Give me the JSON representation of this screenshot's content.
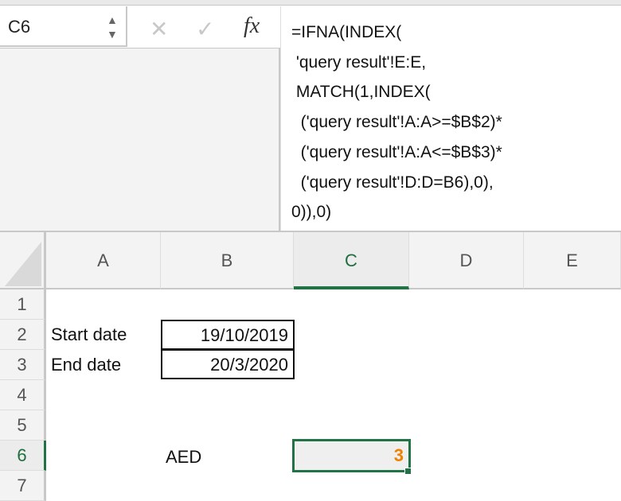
{
  "name_box": {
    "value": "C6"
  },
  "formula_bar": {
    "cancel_icon": "✕",
    "enter_icon": "✓",
    "fx_label": "fx",
    "formula": "=IFNA(INDEX(\n 'query result'!E:E,\n MATCH(1,INDEX(\n  ('query result'!A:A>=$B$2)*\n  ('query result'!A:A<=$B$3)*\n  ('query result'!D:D=B6),0),\n0)),0)"
  },
  "columns": [
    "A",
    "B",
    "C",
    "D",
    "E"
  ],
  "rows": [
    "1",
    "2",
    "3",
    "4",
    "5",
    "6",
    "7"
  ],
  "selected_cell": "C6",
  "cells": {
    "A2": "Start date",
    "B2": "19/10/2019",
    "A3": "End date",
    "B3": "20/3/2020",
    "B6": "AED",
    "C6": "3"
  },
  "colors": {
    "accent": "#217346",
    "result": "#f08000"
  }
}
